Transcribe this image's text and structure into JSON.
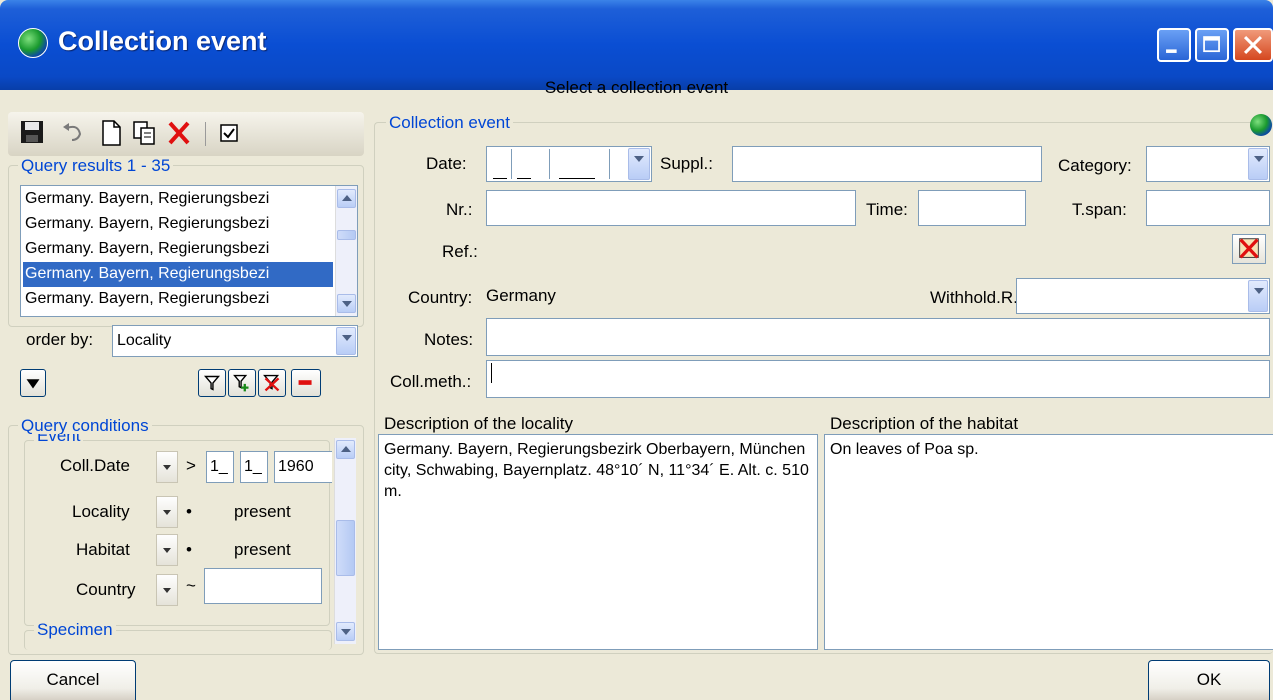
{
  "window": {
    "title": "Collection event",
    "caption": "Select a collection event"
  },
  "query_results": {
    "label": "Query results   1 - 35",
    "items": [
      "Germany. Bayern, Regierungsbezi",
      "Germany. Bayern, Regierungsbezi",
      "Germany. Bayern, Regierungsbezi",
      "Germany. Bayern, Regierungsbezi",
      "Germany. Bayern, Regierungsbezi"
    ],
    "selected_index": 3,
    "order_by_label": "order by:",
    "order_by_value": "Locality"
  },
  "query_conditions": {
    "label": "Query conditions",
    "clipped_group": "Event",
    "rows": [
      {
        "label": "Coll.Date",
        "op": ">",
        "day": "1_",
        "month": "1_",
        "year": "1960"
      },
      {
        "label": "Locality",
        "op": "•",
        "value": "present"
      },
      {
        "label": "Habitat",
        "op": "•",
        "value": "present"
      },
      {
        "label": "Country",
        "op": "~",
        "value": ""
      }
    ],
    "next_group": "Specimen"
  },
  "collection_event": {
    "group_label": "Collection event",
    "date_label": "Date:",
    "suppl_label": "Suppl.:",
    "suppl_value": "",
    "category_label": "Category:",
    "category_value": "",
    "nr_label": "Nr.:",
    "nr_value": "",
    "time_label": "Time:",
    "time_value": "",
    "tspan_label": "T.span:",
    "tspan_value": "",
    "ref_label": "Ref.:",
    "country_label": "Country:",
    "country_value": "Germany",
    "withhold_label": "Withhold.R.:",
    "withhold_value": "",
    "notes_label": "Notes:",
    "notes_value": "",
    "collmeth_label": "Coll.meth.:",
    "collmeth_value": "",
    "locality_desc_label": "Description of the locality",
    "locality_desc": "Germany. Bayern, Regierungsbezirk Oberbayern, München city, Schwabing, Bayernplatz. 48°10´ N, 11°34´ E. Alt. c. 510 m.",
    "habitat_desc_label": "Description of the habitat",
    "habitat_desc": "On leaves of Poa sp."
  },
  "buttons": {
    "cancel": "Cancel",
    "ok": "OK"
  },
  "colors": {
    "title_bar": "#0a4ed3",
    "group_label": "#0046d5",
    "selection": "#316ac5",
    "delete_red": "#e01010"
  }
}
